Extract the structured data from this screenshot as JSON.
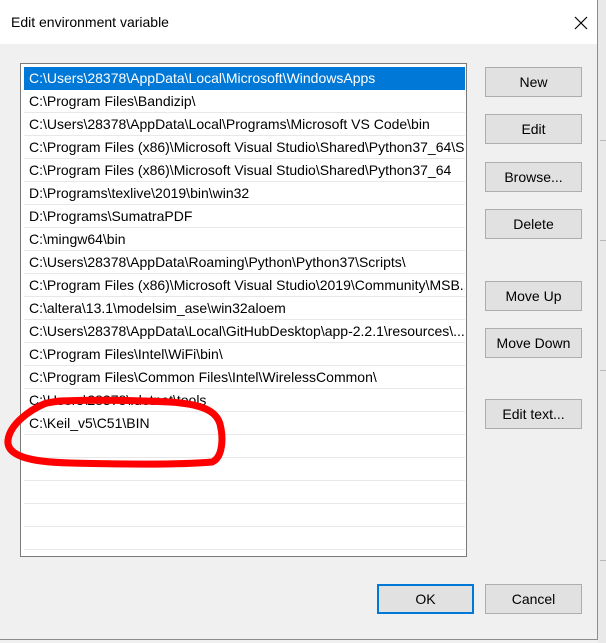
{
  "dialog": {
    "title": "Edit environment variable"
  },
  "paths": [
    "C:\\Users\\28378\\AppData\\Local\\Microsoft\\WindowsApps",
    "C:\\Program Files\\Bandizip\\",
    "C:\\Users\\28378\\AppData\\Local\\Programs\\Microsoft VS Code\\bin",
    "C:\\Program Files (x86)\\Microsoft Visual Studio\\Shared\\Python37_64\\S...",
    "C:\\Program Files (x86)\\Microsoft Visual Studio\\Shared\\Python37_64",
    "D:\\Programs\\texlive\\2019\\bin\\win32",
    "D:\\Programs\\SumatraPDF",
    "C:\\mingw64\\bin",
    "C:\\Users\\28378\\AppData\\Roaming\\Python\\Python37\\Scripts\\",
    "C:\\Program Files (x86)\\Microsoft Visual Studio\\2019\\Community\\MSB...",
    "C:\\altera\\13.1\\modelsim_ase\\win32aloem",
    "C:\\Users\\28378\\AppData\\Local\\GitHubDesktop\\app-2.2.1\\resources\\...",
    "C:\\Program Files\\Intel\\WiFi\\bin\\",
    "C:\\Program Files\\Common Files\\Intel\\WirelessCommon\\",
    "C:\\Users\\28378\\.dotnet\\tools",
    "C:\\Keil_v5\\C51\\BIN"
  ],
  "selected_index": 0,
  "buttons": {
    "new": "New",
    "edit": "Edit",
    "browse": "Browse...",
    "delete": "Delete",
    "move_up": "Move Up",
    "move_down": "Move Down",
    "edit_text": "Edit text...",
    "ok": "OK",
    "cancel": "Cancel"
  },
  "colors": {
    "selection": "#0078d7",
    "annotation": "#ff0000"
  },
  "icons": {
    "close": "close-icon"
  }
}
